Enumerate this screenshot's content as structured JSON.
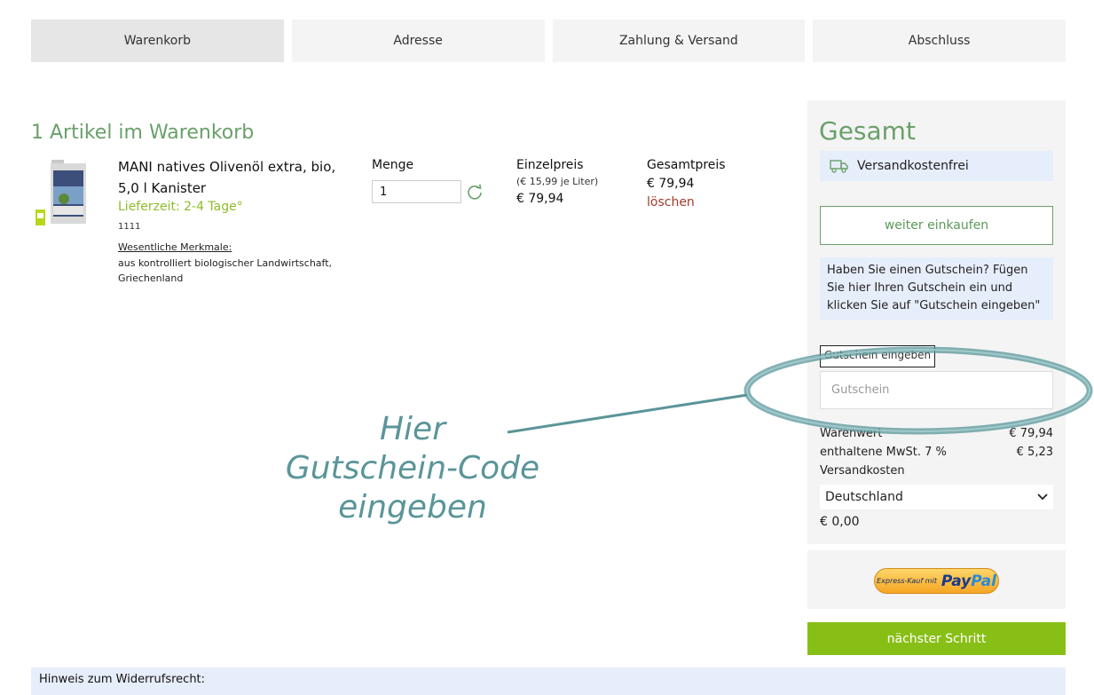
{
  "steps": [
    {
      "label": "Warenkorb",
      "active": true
    },
    {
      "label": "Adresse",
      "active": false
    },
    {
      "label": "Zahlung & Versand",
      "active": false
    },
    {
      "label": "Abschluss",
      "active": false
    }
  ],
  "cart": {
    "title": "1 Artikel im Warenkorb",
    "columns": {
      "quantity": "Menge",
      "unit_price": "Einzelpreis",
      "total_price": "Gesamtpreis"
    },
    "item": {
      "name": "MANI natives Olivenöl extra, bio, 5,0 l Kanister",
      "delivery": "Lieferzeit: 2-4 Tage°",
      "sku": "1111",
      "features_title": "Wesentliche Merkmale:",
      "features": "aus kontrolliert biologischer Landwirtschaft, Griechenland",
      "quantity": "1",
      "unit_note": "(€ 15,99 je Liter)",
      "unit_price": "€ 79,94",
      "total_price": "€ 79,94",
      "delete": "löschen"
    }
  },
  "summary": {
    "title": "Gesamt",
    "shipping_free": "Versandkostenfrei",
    "continue_shopping": "weiter einkaufen",
    "voucher_note": "Haben Sie einen Gutschein? Fügen Sie hier Ihren Gutschein ein und klicken Sie auf \"Gutschein eingeben\"",
    "voucher_label": "Gutschein eingeben",
    "voucher_placeholder": "Gutschein",
    "goods_value_label": "Warenwert",
    "goods_value": "€ 79,94",
    "vat_label": "enthaltene MwSt. 7 %",
    "vat": "€ 5,23",
    "shipping_label": "Versandkosten",
    "country": "Deutschland",
    "shipping_cost": "€ 0,00"
  },
  "paypal": {
    "small": "Express-Kauf mit",
    "logo_a": "Pay",
    "logo_b": "Pal"
  },
  "next_step": "nächster Schritt",
  "notice": "Hinweis zum Widerrufsrecht:",
  "annotation": {
    "line1": "Hier",
    "line2": "Gutschein-Code",
    "line3": "eingeben"
  },
  "colors": {
    "accent_green": "#6aa06a",
    "button_green": "#88bf16",
    "annotation": "#5a9599"
  },
  "icons": [
    "truck-icon",
    "refresh-icon",
    "chevron-down-icon",
    "product-image"
  ]
}
